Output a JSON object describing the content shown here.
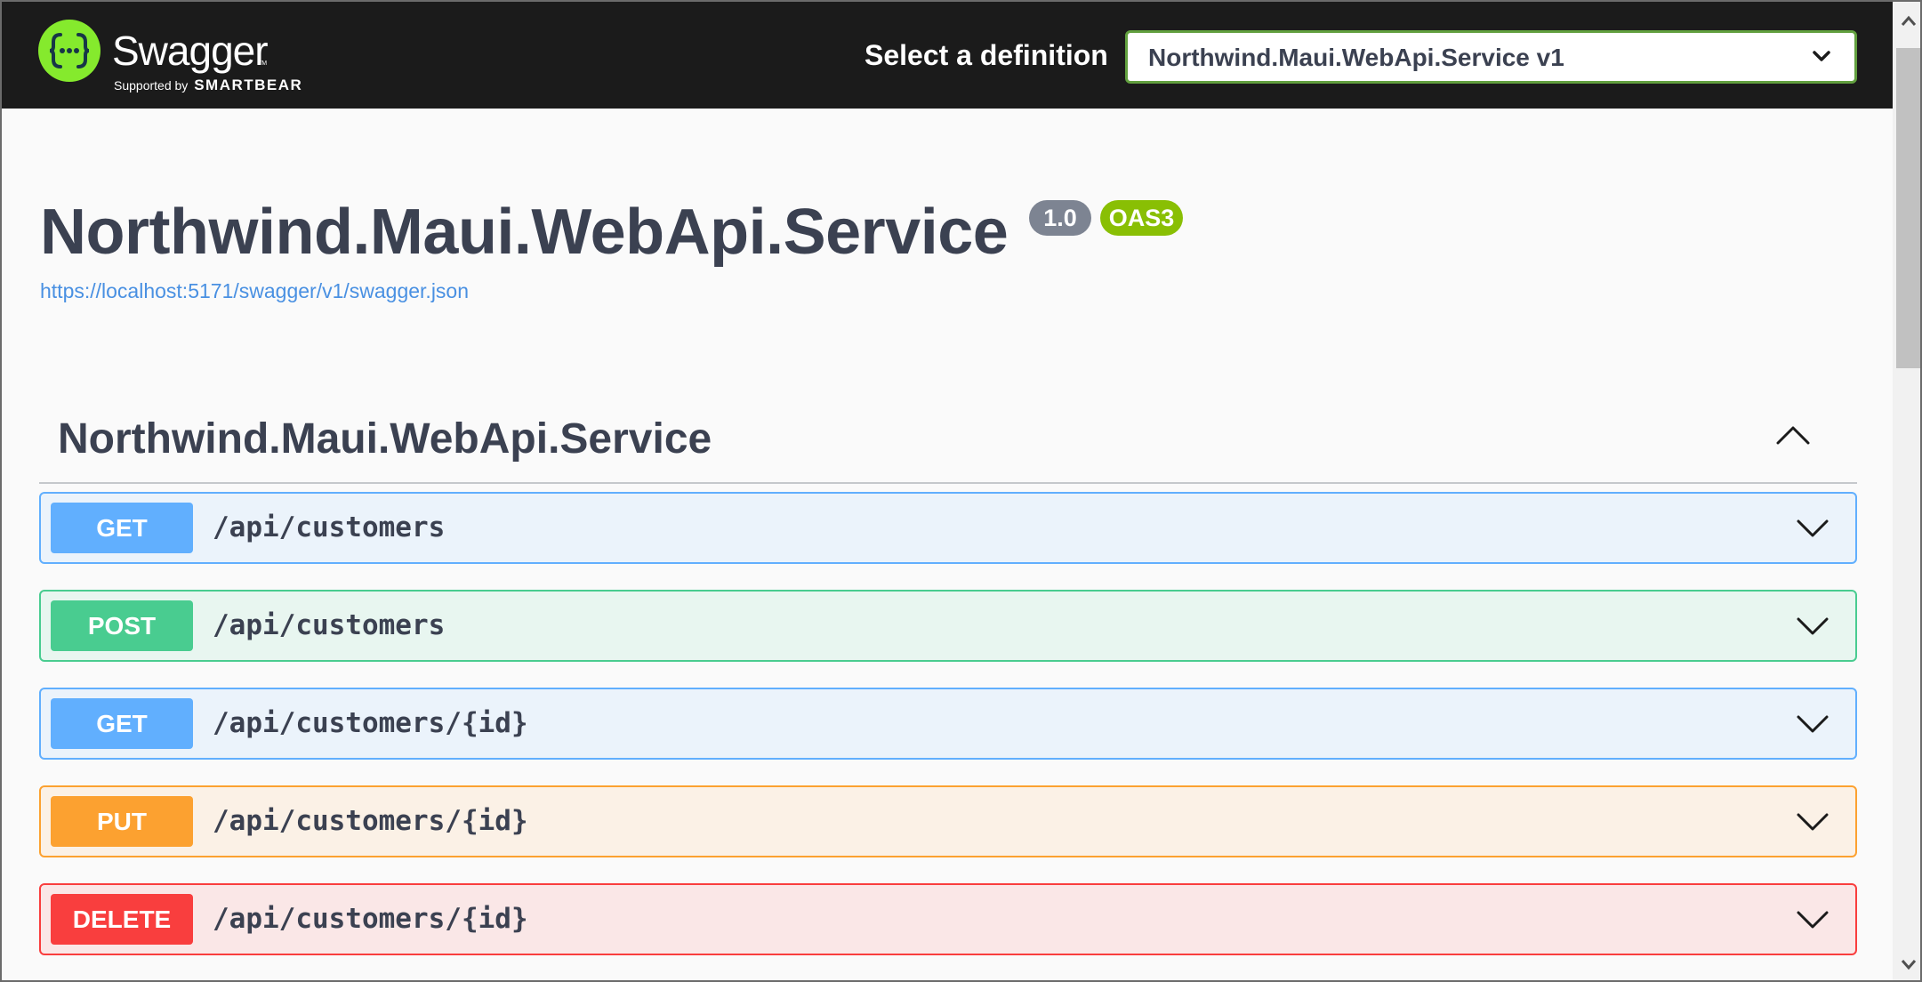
{
  "header": {
    "brand": "Swagger",
    "brand_sub": "Supported by",
    "brand_company": "SMARTBEAR",
    "select_label": "Select a definition",
    "selected_definition": "Northwind.Maui.WebApi.Service v1"
  },
  "info": {
    "title": "Northwind.Maui.WebApi.Service",
    "version": "1.0",
    "oas": "OAS3",
    "spec_url": "https://localhost:5171/swagger/v1/swagger.json"
  },
  "tag": {
    "name": "Northwind.Maui.WebApi.Service",
    "expanded": true
  },
  "operations": [
    {
      "method": "GET",
      "path": "/api/customers"
    },
    {
      "method": "POST",
      "path": "/api/customers"
    },
    {
      "method": "GET",
      "path": "/api/customers/{id}"
    },
    {
      "method": "PUT",
      "path": "/api/customers/{id}"
    },
    {
      "method": "DELETE",
      "path": "/api/customers/{id}"
    }
  ],
  "colors": {
    "topbar": "#1b1b1b",
    "logo": "#85ea2d",
    "get": "#61affe",
    "post": "#49cc90",
    "put": "#fca130",
    "delete": "#f93e3e"
  },
  "icons": {
    "logo": "swagger-braces-icon",
    "dropdown": "chevron-down-icon",
    "collapse": "chevron-up-icon",
    "expand": "chevron-down-icon"
  }
}
